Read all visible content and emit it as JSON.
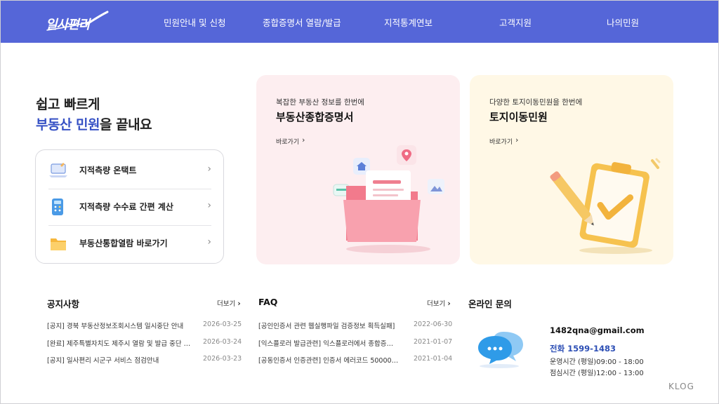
{
  "brand": {
    "logo_text": "일사편리"
  },
  "nav": [
    {
      "label": "민원안내 및 신청"
    },
    {
      "label": "종합증명서 열람/발급"
    },
    {
      "label": "지적통계연보"
    },
    {
      "label": "고객지원"
    },
    {
      "label": "나의민원"
    }
  ],
  "hero": {
    "line1": "쉽고 빠르게",
    "line2_accent": "부동산 민원",
    "line2_rest": "을 끝내요"
  },
  "quick_links": [
    {
      "label": "지적측량 온택트",
      "icon": "laptop-icon"
    },
    {
      "label": "지적측량 수수료 간편 계산",
      "icon": "calculator-icon"
    },
    {
      "label": "부동산통합열람 바로가기",
      "icon": "folder-icon"
    }
  ],
  "cards": [
    {
      "subtitle": "복잡한 부동산 정보를 한번에",
      "title": "부동산종합증명서",
      "link": "바로가기",
      "icon": "document-folder-icon"
    },
    {
      "subtitle": "다양한 토지이동민원을 한번에",
      "title": "토지이동민원",
      "link": "바로가기",
      "icon": "clipboard-check-icon"
    }
  ],
  "notices": {
    "title": "공지사항",
    "more": "더보기",
    "items": [
      {
        "title": "[공지] 경북 부동산정보조회시스템 일시중단 안내",
        "date": "2026-03-25"
      },
      {
        "title": "[완료] 제주특별자치도 제주시 열람 및 발급 중단 …",
        "date": "2026-03-24"
      },
      {
        "title": "[공지] 일사편리 시군구 서비스 점검안내",
        "date": "2026-03-23"
      }
    ]
  },
  "faq": {
    "title": "FAQ",
    "more": "더보기",
    "items": [
      {
        "title": "[공인인증서 관련 웹실행파일 검증정보 획득실패]",
        "date": "2022-06-30"
      },
      {
        "title": "[익스플로러 발급관련] 익스플로러에서 종합증명…",
        "date": "2021-01-07"
      },
      {
        "title": "[공동인증서 인증관련] 인증서 에러코드 500000…",
        "date": "2021-01-04"
      }
    ]
  },
  "online": {
    "title": "온라인 문의",
    "email": "1482qna@gmail.com",
    "phone": "전화 1599-1483",
    "hours": "운영시간 (평일)09:00 - 18:00",
    "lunch": "점심시간 (평일)12:00 - 13:00"
  },
  "watermark": "KLOG",
  "colors": {
    "nav_bg": "#5566d8",
    "accent": "#3550c4",
    "pink_card": "#fdeef0",
    "yellow_card": "#fff8e6"
  }
}
